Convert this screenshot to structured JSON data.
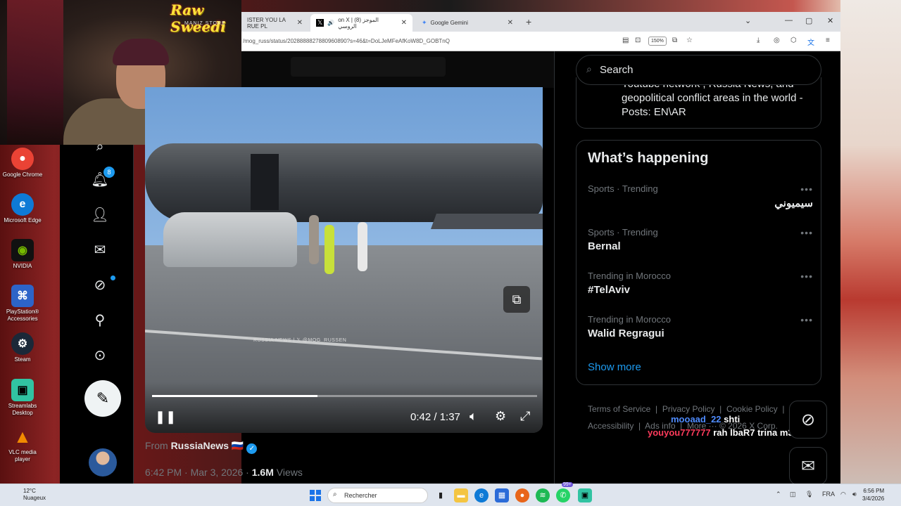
{
  "browser": {
    "tabs": [
      {
        "label": "ISTER YOU LA RUE PL",
        "favicon": "tab-favicon"
      },
      {
        "label": "on X | (8) الموجز الروسي",
        "favicon": "x-logo-icon",
        "active": true
      },
      {
        "label": "Google Gemini",
        "favicon": "gemini-icon"
      }
    ],
    "url": "/mog_russ/status/2028888827880960890?s=46&t=DoLJeMFeAfKoW8D_GOBTnQ",
    "zoom": "150%"
  },
  "webcam": {
    "logo": "Raw Sweedi",
    "logo_sub": "MANIZ STORE"
  },
  "desktop_icons": [
    {
      "label": "Google Chrome",
      "icon": "chrome-icon",
      "color": "#ea4335"
    },
    {
      "label": "Microsoft Edge",
      "icon": "edge-icon",
      "color": "#0e7ad6"
    },
    {
      "label": "NVIDIA",
      "icon": "nvidia-icon",
      "color": "#76b900"
    },
    {
      "label": "PlayStation® Accessories",
      "icon": "playstation-icon",
      "color": "#2d64c8"
    },
    {
      "label": "Steam",
      "icon": "steam-icon",
      "color": "#1b2838"
    },
    {
      "label": "Streamlabs Desktop",
      "icon": "streamlabs-icon",
      "color": "#31c3a2"
    },
    {
      "label": "VLC media player",
      "icon": "vlc-icon",
      "color": "#f18a00"
    }
  ],
  "nav": {
    "notifications_badge": "8"
  },
  "video": {
    "watermark": "RUSSIA NEWS | 𝕏 @MOG_RUSSEN",
    "time": "0:42 / 1:37",
    "progress": 0.43
  },
  "post": {
    "from_label": "From",
    "source": "RussiaNews 🇷🇺",
    "timestamp": "6:42 PM · Mar 3, 2026 · ",
    "views_count": "1.6M",
    "views_label": " Views"
  },
  "right": {
    "search_placeholder": "Search",
    "who_text": "Youtube network , Russia News, and geopolitical conflict areas in the world - Posts: EN\\AR",
    "happening_title": "What’s happening",
    "trends": [
      {
        "category": "Sports · Trending",
        "name": "سيميوني",
        "rtl": true
      },
      {
        "category": "Sports · Trending",
        "name": "Bernal"
      },
      {
        "category": "Trending in Morocco",
        "name": "#TelAviv"
      },
      {
        "category": "Trending in Morocco",
        "name": "Walid Regragui"
      }
    ],
    "show_more": "Show more",
    "footer": [
      "Terms of Service",
      "Privacy Policy",
      "Cookie Policy",
      "Accessibility",
      "Ads info",
      "More ···",
      "© 2026 X Corp."
    ]
  },
  "chat": [
    {
      "user": "mooaad_22",
      "msg": "shti",
      "color": "#4f8cff"
    },
    {
      "user": "youyou777777",
      "msg": "rah lbaR7 trina m3ahom",
      "color": "#ff3b5c"
    }
  ],
  "taskbar": {
    "weather_temp": "12°C",
    "weather_desc": "Nuageux",
    "search_label": "Rechercher",
    "lang": "FRA",
    "time": "6:56 PM",
    "date": "3/4/2026",
    "spotify_badge": "99+"
  }
}
